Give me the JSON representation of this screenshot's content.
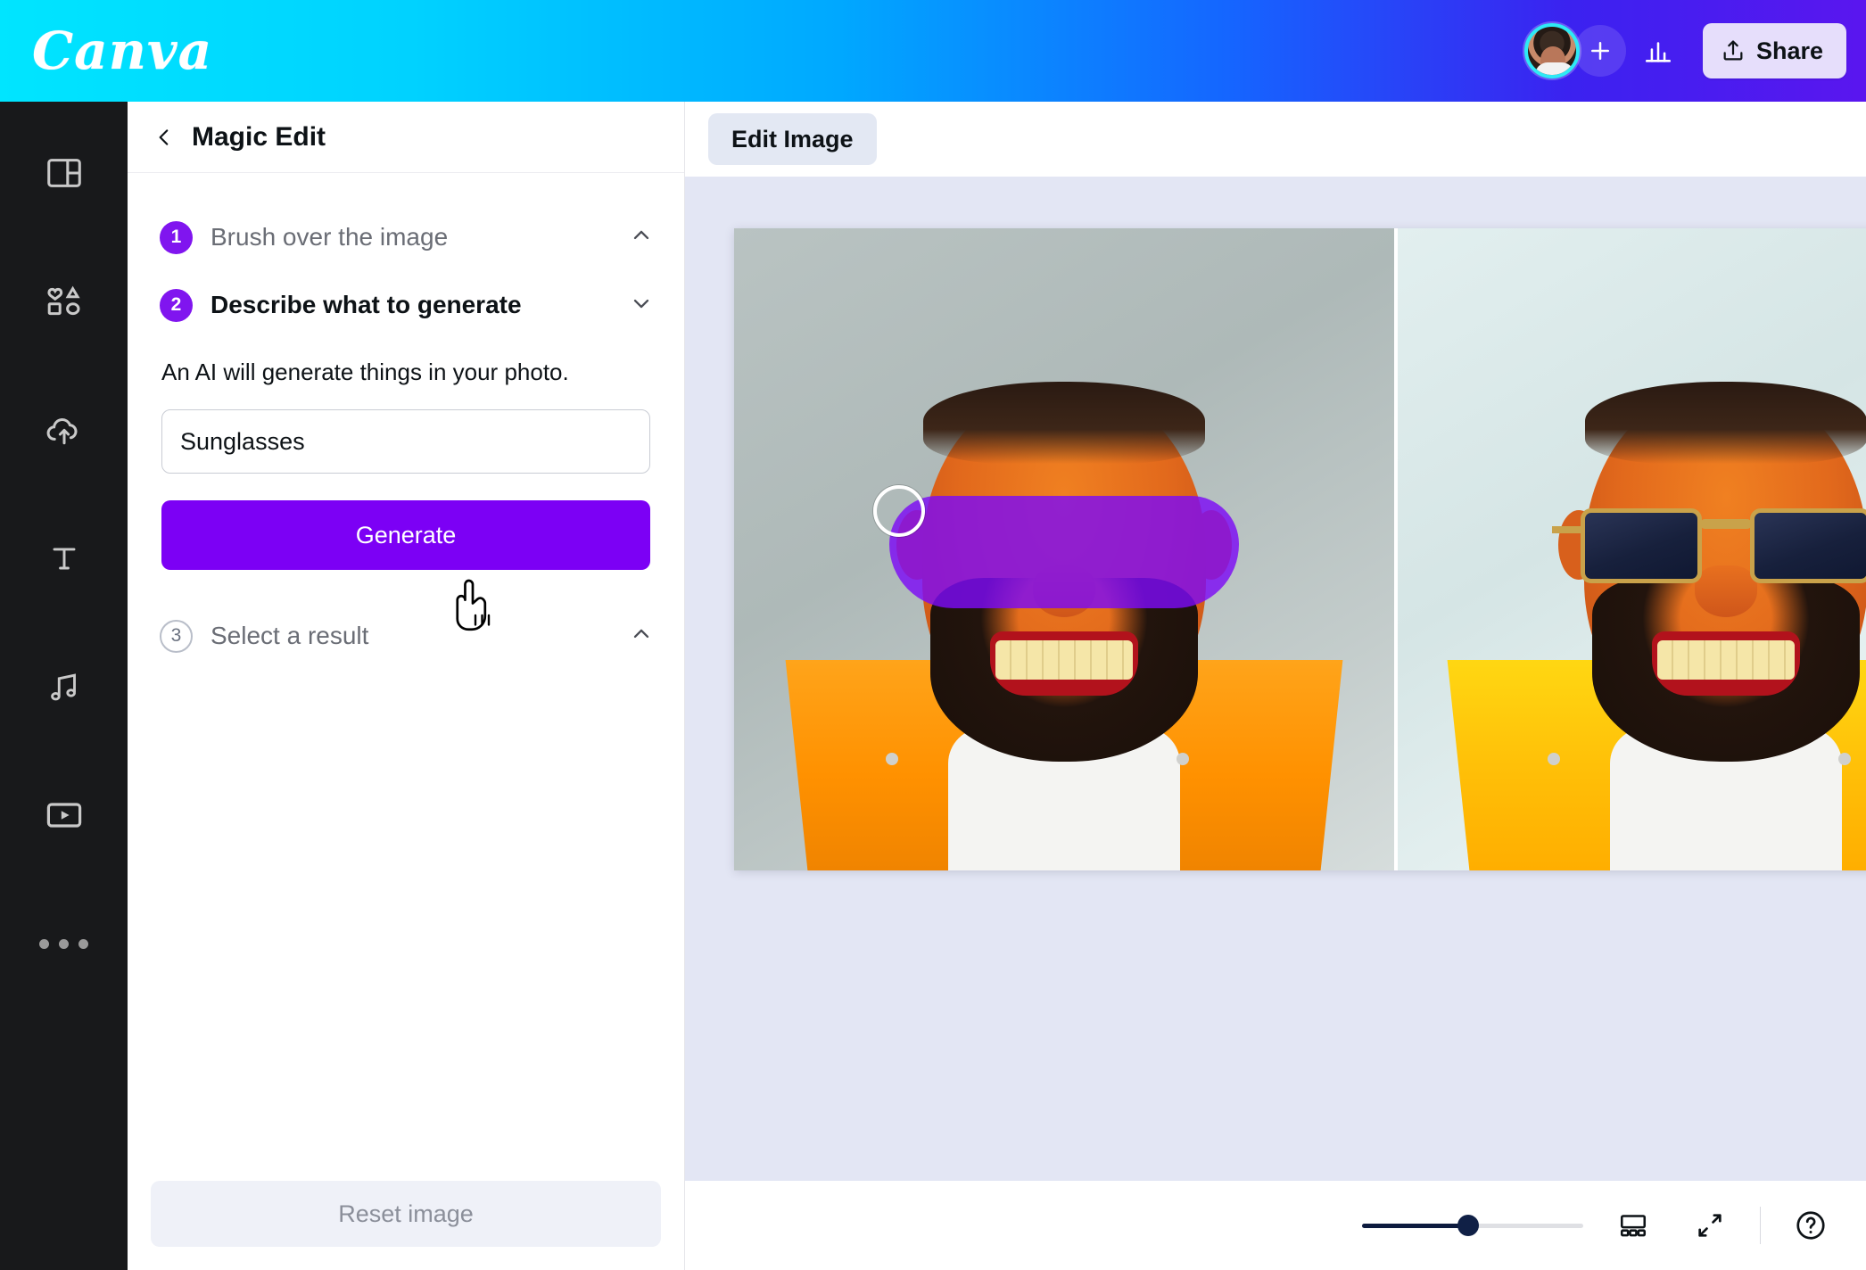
{
  "app": {
    "brand": "Canva"
  },
  "topbar": {
    "avatar_name": "user-avatar",
    "add_member_label": "+",
    "analytics_icon": "bar-chart-icon",
    "share_label": "Share",
    "share_icon": "upload-icon"
  },
  "rail": {
    "items": [
      {
        "name": "design",
        "icon": "layout-grid-icon"
      },
      {
        "name": "elements",
        "icon": "shapes-icon"
      },
      {
        "name": "uploads",
        "icon": "cloud-upload-icon"
      },
      {
        "name": "text",
        "icon": "text-t-icon"
      },
      {
        "name": "audio",
        "icon": "music-note-icon"
      },
      {
        "name": "videos",
        "icon": "play-rectangle-icon"
      },
      {
        "name": "more",
        "icon": "ellipsis-icon"
      }
    ]
  },
  "panel": {
    "back_icon": "chevron-left-icon",
    "title": "Magic Edit",
    "steps": [
      {
        "number": "1",
        "label": "Brush over the image",
        "state": "inactive",
        "chevron": "chevron-up-icon"
      },
      {
        "number": "2",
        "label": "Describe what to generate",
        "state": "active",
        "chevron": "chevron-down-icon"
      },
      {
        "number": "3",
        "label": "Select a result",
        "state": "pending",
        "chevron": "chevron-up-icon"
      }
    ],
    "helper_text": "An AI will generate things in your photo.",
    "prompt_value": "Sunglasses",
    "prompt_placeholder": "Describe what to generate",
    "generate_label": "Generate",
    "reset_label": "Reset image",
    "accent_color": "#8015ef",
    "generate_color": "#7c00f5"
  },
  "main": {
    "edit_image_label": "Edit Image",
    "canvas_bg": "#e3e6f4",
    "brush_mask_color": "#7c0bf5",
    "brush_cursor": "brush-circle-cursor",
    "pointer_cursor": "hand-pointer-cursor"
  },
  "bottombar": {
    "zoom_percent": 48,
    "grid_icon": "pages-grid-icon",
    "expand_icon": "expand-arrows-icon",
    "help_icon": "help-question-icon"
  }
}
